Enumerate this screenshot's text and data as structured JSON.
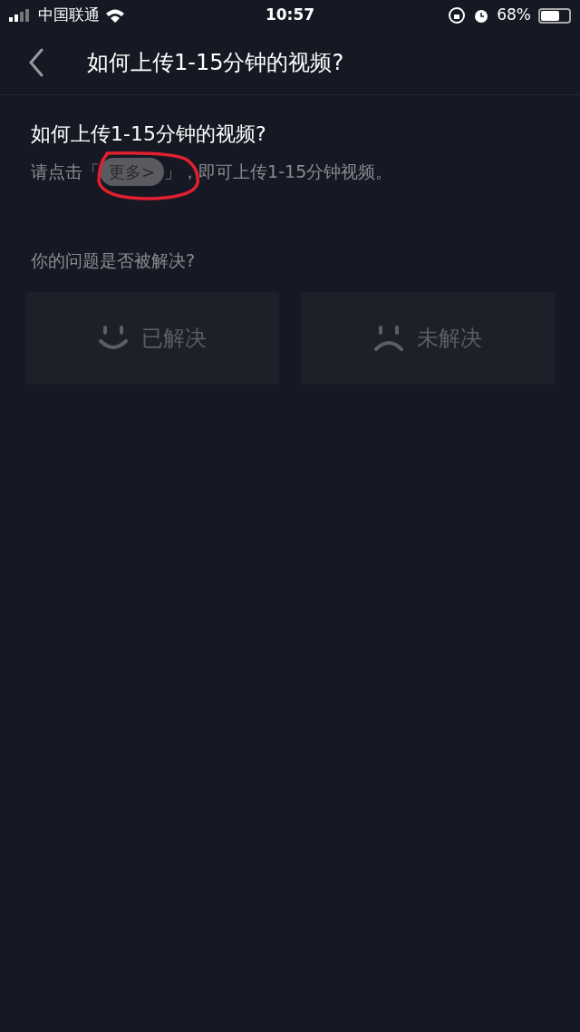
{
  "status_bar": {
    "carrier": "中国联通",
    "time": "10:57",
    "battery": "68%"
  },
  "nav": {
    "title": "如何上传1-15分钟的视频?"
  },
  "article": {
    "title": "如何上传1-15分钟的视频?",
    "text_before": "请点击「",
    "chip": "更多>",
    "text_after": "」，即可上传1-15分钟视频。"
  },
  "feedback": {
    "question": "你的问题是否被解决?",
    "options": [
      {
        "kind": "smile",
        "label": "已解决"
      },
      {
        "kind": "frown",
        "label": "未解决"
      }
    ]
  }
}
